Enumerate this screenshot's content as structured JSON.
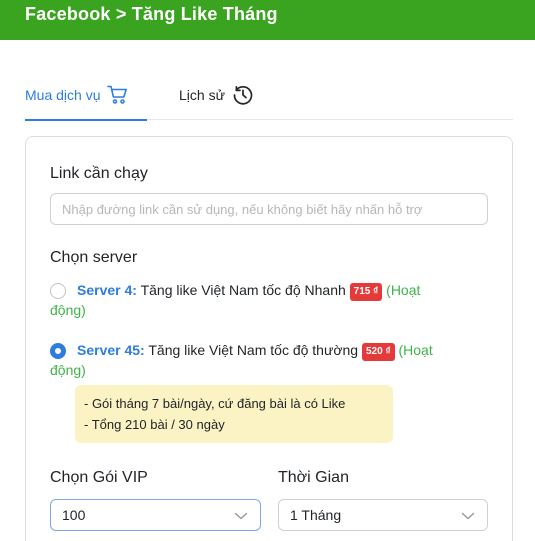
{
  "header": {
    "title": "Facebook > Tăng Like Tháng"
  },
  "tabs": [
    {
      "label": "Mua dịch vụ",
      "icon": "cart-icon"
    },
    {
      "label": "Lịch sử",
      "icon": "clock-history-icon"
    }
  ],
  "form": {
    "link_label": "Link cần chạy",
    "link_placeholder": "Nhập đường link cần sử dụng, nếu không biết hãy nhấn hỗ trợ",
    "server_label": "Chọn server",
    "servers": [
      {
        "name": "Server 4:",
        "desc": "Tăng like Việt Nam tốc độ Nhanh",
        "price": "715 ₫",
        "status": "(Hoạt",
        "status_wrap": "động)",
        "selected": false
      },
      {
        "name": "Server 45:",
        "desc": "Tăng like Việt Nam tốc độ thường",
        "price": "520 ₫",
        "status": "(Hoạt",
        "status_wrap": "động)",
        "selected": true
      }
    ],
    "notes": [
      "- Gói tháng 7 bài/ngày, cứ đăng bài là có Like",
      "- Tổng 210 bài / 30 ngày"
    ],
    "vip_label": "Chọn Gói VIP",
    "vip_value": "100",
    "time_label": "Thời Gian",
    "time_value": "1 Tháng"
  },
  "colors": {
    "header_bg": "#3aa31f",
    "accent": "#2d7de0",
    "price_badge": "#e53a3a",
    "status_green": "#3fb34a",
    "note_bg": "#fcf3c4"
  }
}
